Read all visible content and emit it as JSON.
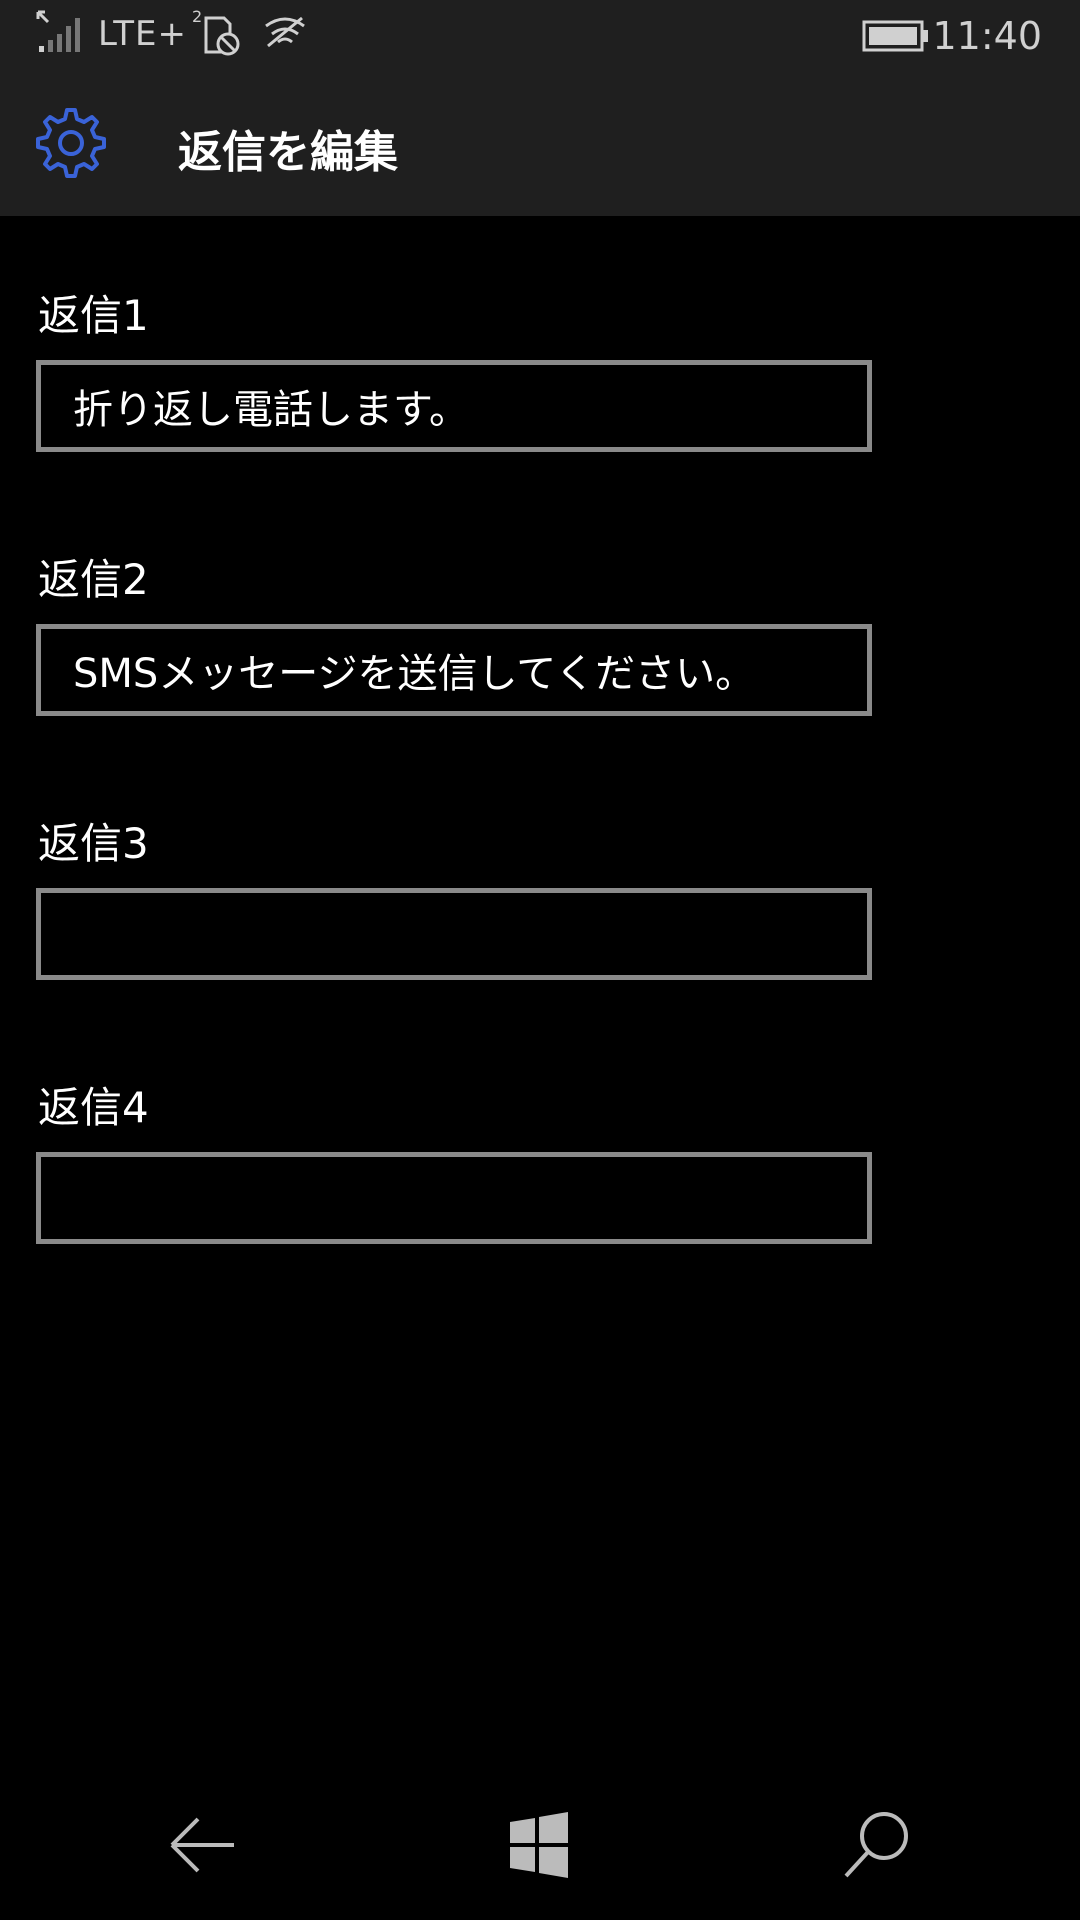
{
  "status_bar": {
    "network": "LTE+",
    "time": "11:40",
    "sim_number": "2"
  },
  "header": {
    "title": "返信を編集",
    "icon": "gear-icon",
    "icon_color": "#3a63d8"
  },
  "replies": [
    {
      "label": "返信1",
      "value": "折り返し電話します。"
    },
    {
      "label": "返信2",
      "value": "SMSメッセージを送信してください。"
    },
    {
      "label": "返信3",
      "value": ""
    },
    {
      "label": "返信4",
      "value": ""
    }
  ],
  "nav_bar": {
    "back_icon": "back-arrow-icon",
    "home_icon": "windows-logo-icon",
    "search_icon": "search-icon"
  }
}
